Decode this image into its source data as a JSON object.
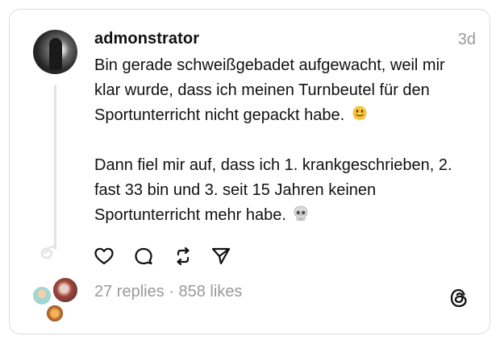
{
  "post": {
    "username": "admonstrator",
    "time": "3d",
    "paragraph1": "Bin gerade schweißgebadet aufgewacht, weil mir klar wurde, dass ich meinen Turnbeutel für den Sportunterricht nicht gepackt habe.",
    "paragraph1_emoji": "melting-face-emoji",
    "paragraph2": "Dann fiel mir auf, dass ich 1. krankgeschrieben, 2. fast 33 bin und 3. seit 15 Jahren keinen Sportunterricht mehr habe.",
    "paragraph2_emoji": "skull-emoji"
  },
  "actions": {
    "like_icon": "heart-icon",
    "reply_icon": "comment-bubble-icon",
    "repost_icon": "repost-icon",
    "share_icon": "send-icon"
  },
  "stats": {
    "replies": "27 replies",
    "separator": " · ",
    "likes": "858 likes"
  },
  "branding": {
    "logo_icon": "threads-logo-icon"
  },
  "colors": {
    "text": "#101010",
    "muted": "#9a9a9a",
    "border": "#dcdcdc"
  }
}
